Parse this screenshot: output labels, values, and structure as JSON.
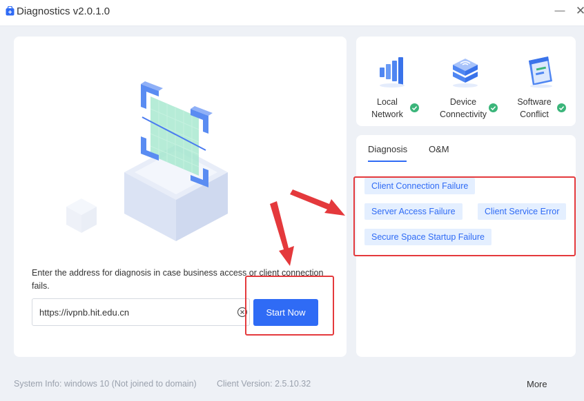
{
  "window": {
    "title": "Diagnostics v2.0.1.0",
    "minimize_glyph": "—",
    "close_glyph": "✕"
  },
  "left_panel": {
    "description": "Enter the address for diagnosis in case business access or client connection fails.",
    "address_value": "https://ivpnb.hit.edu.cn",
    "start_label": "Start Now"
  },
  "status": {
    "items": [
      {
        "label_line1": "Local",
        "label_line2": "Network",
        "icon": "signal-bars-icon",
        "ok": true
      },
      {
        "label_line1": "Device",
        "label_line2": "Connectivity",
        "icon": "wifi-server-icon",
        "ok": true
      },
      {
        "label_line1": "Software",
        "label_line2": "Conflict",
        "icon": "software-window-icon",
        "ok": true
      }
    ]
  },
  "diagnosis": {
    "tabs": [
      {
        "label": "Diagnosis",
        "active": true
      },
      {
        "label": "O&M",
        "active": false
      }
    ],
    "chips": [
      "Client Connection Failure",
      "Server Access Failure",
      "Client Service Error",
      "Secure Space Startup Failure"
    ]
  },
  "footer": {
    "system_info": "System Info: windows 10 (Not joined to domain)",
    "client_version": "Client Version: 2.5.10.32",
    "more_label": "More"
  },
  "colors": {
    "accent": "#2f6bf5",
    "chip_bg": "#e4efff",
    "ok_green": "#3bb57a",
    "annotation_red": "#e4393c"
  }
}
